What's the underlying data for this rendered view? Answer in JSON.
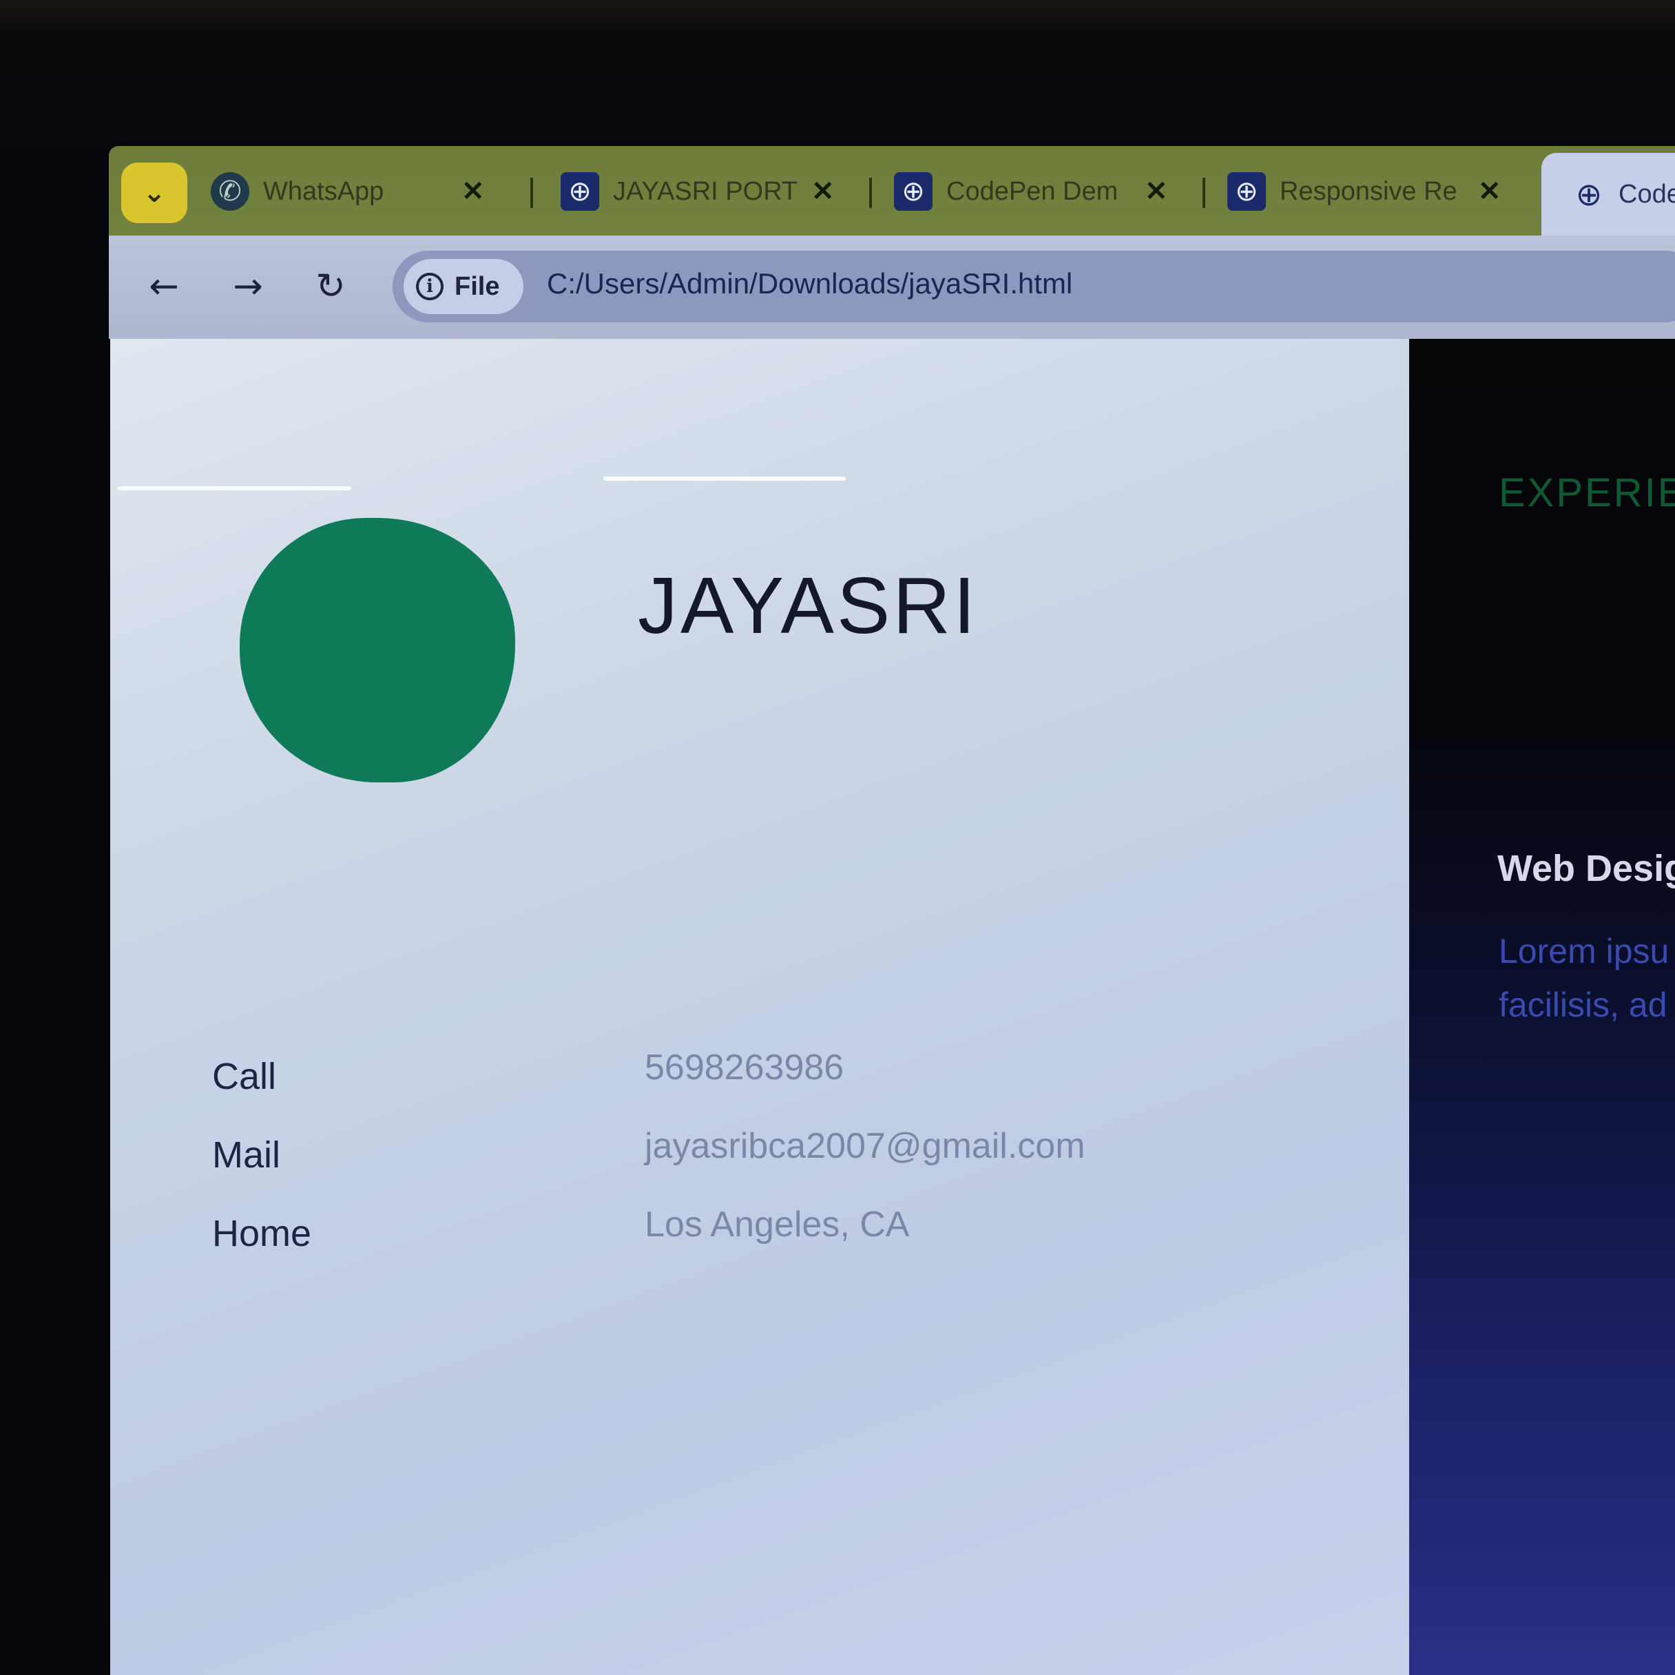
{
  "browser": {
    "tab_search_icon": "chevron-down-icon",
    "tabs": [
      {
        "title": "WhatsApp",
        "icon": "whatsapp-icon"
      },
      {
        "title": "JAYASRI PORT",
        "icon": "globe-icon"
      },
      {
        "title": "CodePen Dem",
        "icon": "globe-icon"
      },
      {
        "title": "Responsive Re",
        "icon": "globe-icon"
      }
    ],
    "active_tab": {
      "title": "Code",
      "icon": "globe-icon"
    },
    "close_glyph": "✕",
    "toolbar": {
      "back_glyph": "←",
      "forward_glyph": "→",
      "reload_glyph": "↻"
    },
    "omnibox": {
      "chip_label": "File",
      "url": "C:/Users/Admin/Downloads/jayaSRI.html"
    }
  },
  "profile": {
    "name": "JAYASRI",
    "avatar_color": "#0f7a58",
    "contacts": [
      {
        "label": "Call",
        "value": "5698263986"
      },
      {
        "label": "Mail",
        "value": "jayasribca2007@gmail.com"
      },
      {
        "label": "Home",
        "value": "Los Angeles, CA"
      }
    ]
  },
  "experience": {
    "heading": "EXPERIEN",
    "job_title": "Web Desig",
    "description_line1": "Lorem ipsu",
    "description_line2": "facilisis, ad"
  }
}
